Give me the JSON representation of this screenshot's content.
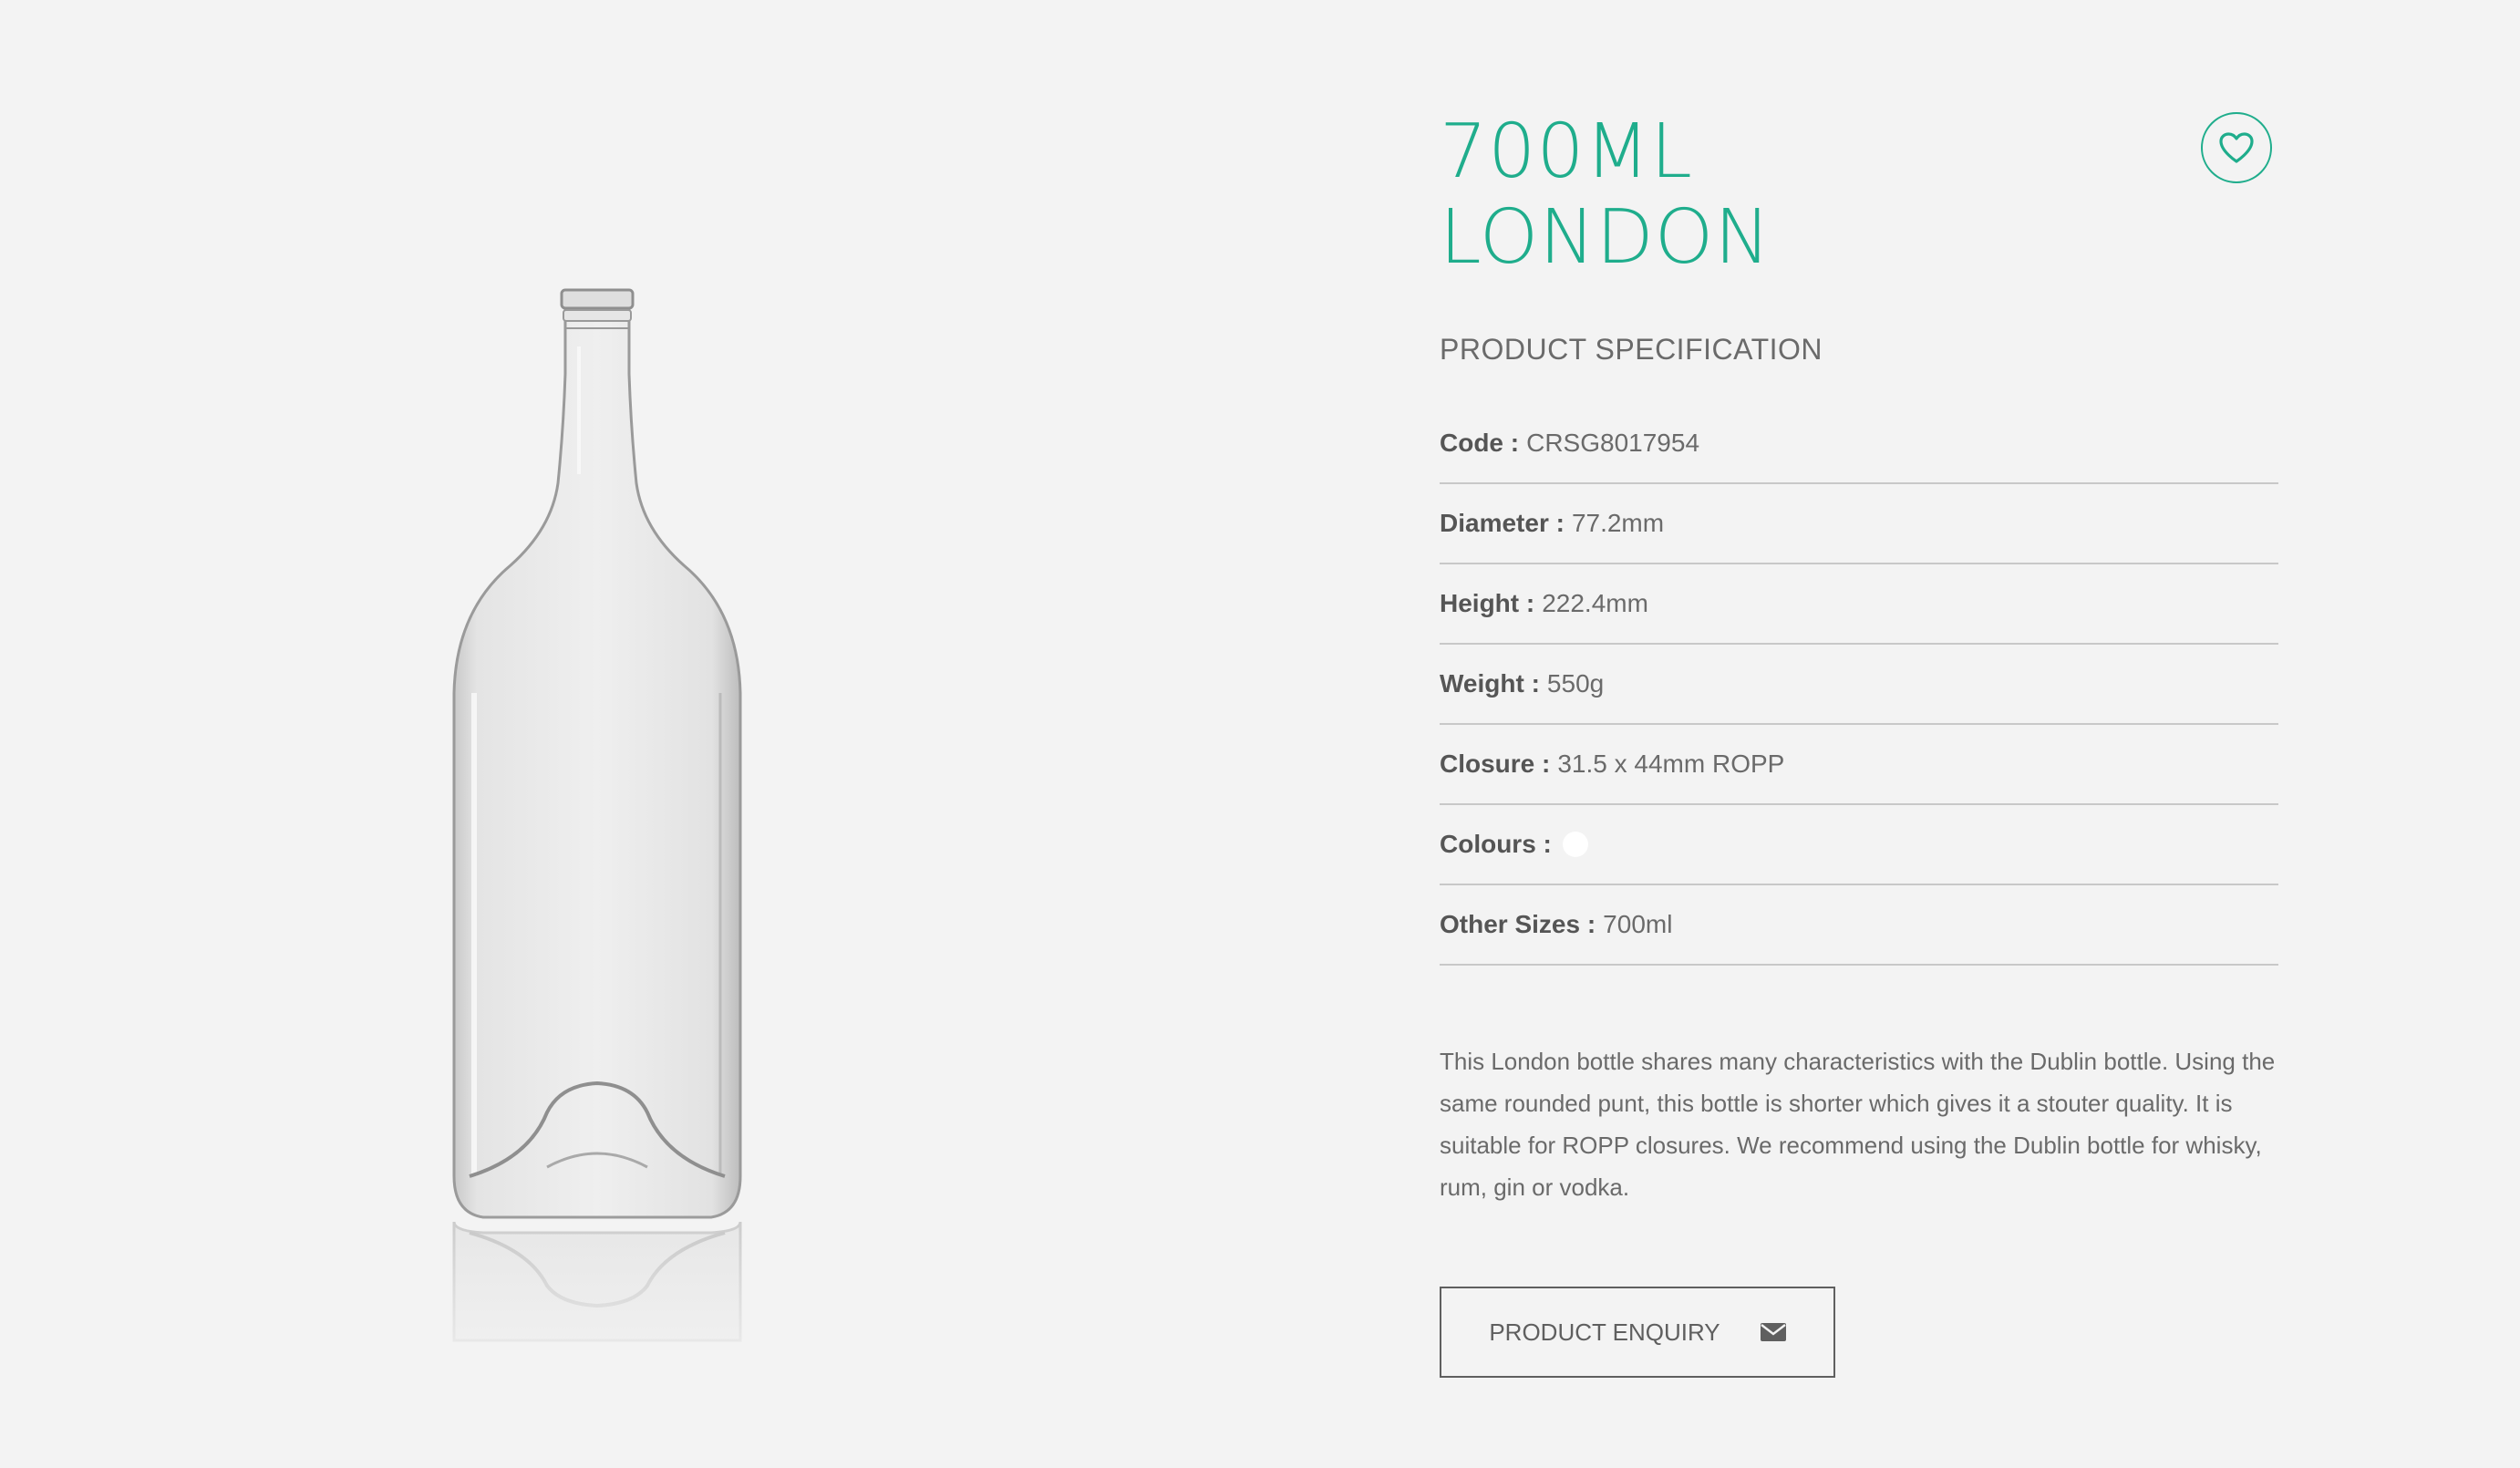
{
  "product": {
    "title_line1": "700ML",
    "title_line2": "LONDON",
    "favourite_icon": "heart-icon",
    "accent_color": "#1fad8c",
    "spec_heading": "PRODUCT SPECIFICATION",
    "specs": [
      {
        "label": "Code :",
        "value": "CRSG8017954"
      },
      {
        "label": "Diameter :",
        "value": "77.2mm"
      },
      {
        "label": "Height :",
        "value": "222.4mm"
      },
      {
        "label": "Weight :",
        "value": "550g"
      },
      {
        "label": "Closure :",
        "value": "31.5 x 44mm ROPP"
      },
      {
        "label": "Colours :",
        "value": "",
        "swatch": "#ffffff"
      },
      {
        "label": "Other Sizes :",
        "value": "700ml"
      }
    ],
    "description": "This London bottle shares many characteristics with the Dublin bottle. Using the same rounded punt, this bottle is shorter which gives it a stouter quality. It is suitable for ROPP closures. We recommend using the Dublin bottle for whisky, rum, gin or vodka.",
    "enquiry_label": "PRODUCT ENQUIRY",
    "enquiry_icon": "envelope-icon"
  }
}
